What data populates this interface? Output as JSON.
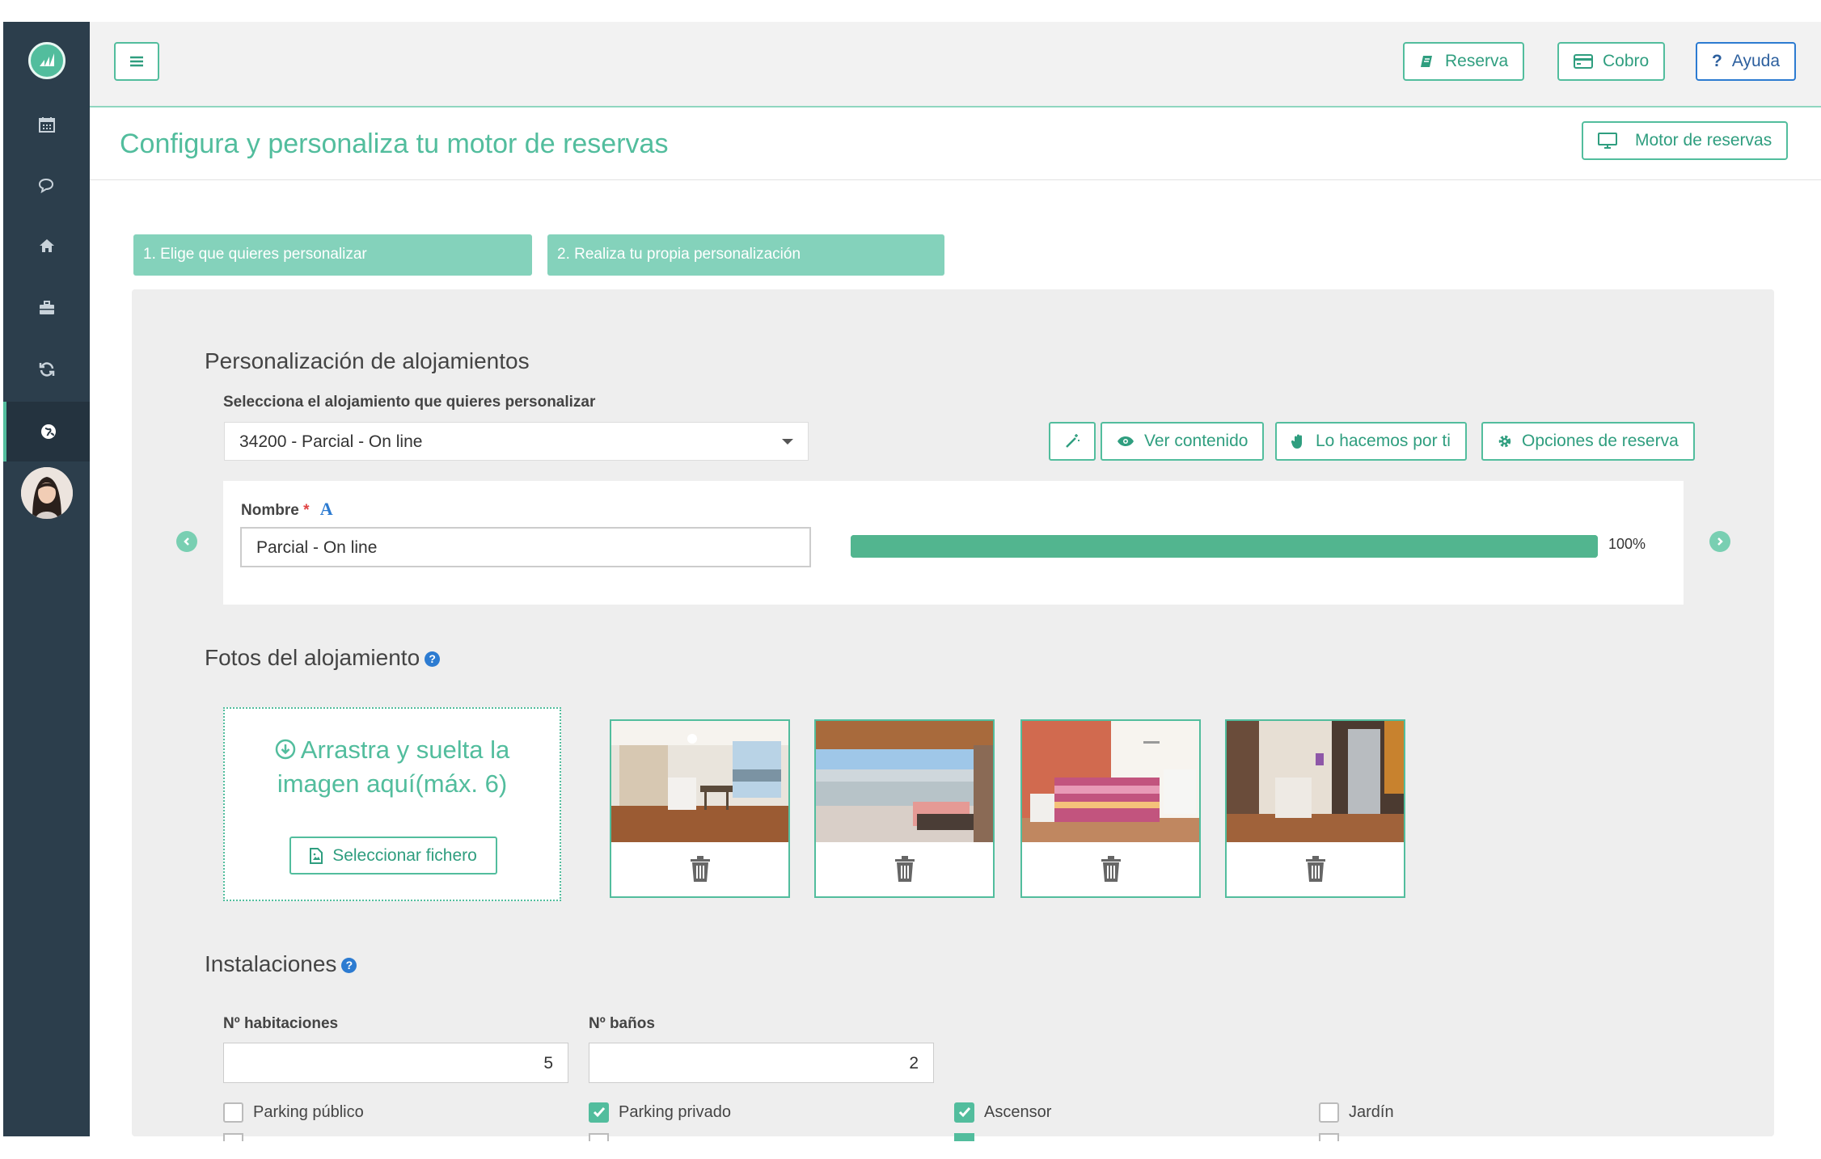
{
  "colors": {
    "accent": "#52bd9d",
    "sidebar": "#2c3e4c",
    "help_blue": "#2c7bd1",
    "panel": "#eeeeee"
  },
  "sidebar": {
    "items": [
      {
        "icon": "calendar-icon"
      },
      {
        "icon": "chat-icon"
      },
      {
        "icon": "home-icon"
      },
      {
        "icon": "briefcase-icon"
      },
      {
        "icon": "refresh-icon"
      },
      {
        "icon": "globe-icon",
        "active": true
      }
    ]
  },
  "topbar": {
    "reserva_label": "Reserva",
    "cobro_label": "Cobro",
    "ayuda_label": "Ayuda"
  },
  "page": {
    "title": "Configura y personaliza tu motor de reservas",
    "motor_label": "Motor de reservas"
  },
  "steps": {
    "step1": "1. Elige que quieres personalizar",
    "step2": "2. Realiza tu propia personalización"
  },
  "alojamientos": {
    "section_title": "Personalización de alojamientos",
    "select_label": "Selecciona el alojamiento que quieres personalizar",
    "selected_value": "34200 - Parcial - On line",
    "buttons": {
      "ver_contenido": "Ver contenido",
      "lo_hacemos": "Lo hacemos por ti",
      "opciones": "Opciones de reserva"
    },
    "nombre_label": "Nombre",
    "required_mark": "*",
    "font_icon_letter": "A",
    "nombre_value": "Parcial - On line",
    "progress": 1.0,
    "progress_text": "100%"
  },
  "fotos": {
    "section_title": "Fotos del alojamiento",
    "help": "?",
    "dropzone_text_line1": "Arrastra y suelta la",
    "dropzone_text_line2": "imagen aquí(máx. 6)",
    "select_file_label": "Seleccionar fichero",
    "photos": [
      "living-room",
      "balcony-sea-view",
      "bedroom",
      "kitchen"
    ]
  },
  "instalaciones": {
    "section_title": "Instalaciones",
    "help": "?",
    "habitaciones_label": "Nº habitaciones",
    "habitaciones_value": "5",
    "banos_label": "Nº baños",
    "banos_value": "2",
    "checks": [
      {
        "label": "Parking público",
        "checked": false
      },
      {
        "label": "Parking privado",
        "checked": true
      },
      {
        "label": "Ascensor",
        "checked": true
      },
      {
        "label": "Jardín",
        "checked": false
      }
    ]
  }
}
